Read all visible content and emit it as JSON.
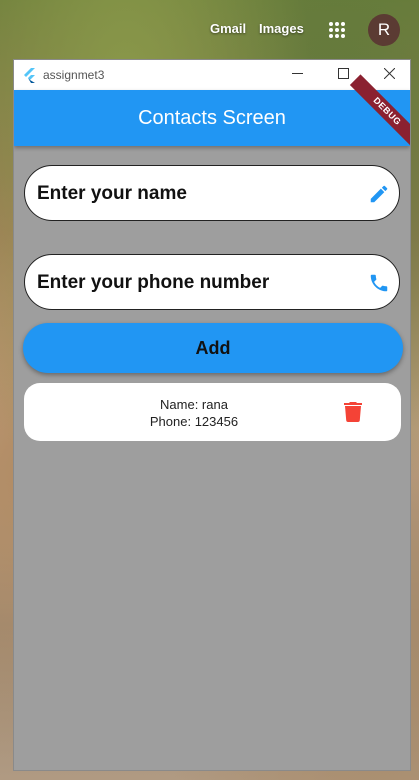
{
  "browser": {
    "links": [
      "Gmail",
      "Images"
    ],
    "avatar_letter": "R"
  },
  "window": {
    "title": "assignmet3",
    "controls": [
      "minimize-icon",
      "maximize-icon",
      "close-icon"
    ]
  },
  "appbar": {
    "title": "Contacts Screen",
    "debug_banner": "DEBUG",
    "color": "#2196f3"
  },
  "form": {
    "name_placeholder": "Enter your name",
    "name_icon": "pencil-icon",
    "phone_placeholder": "Enter your phone number",
    "phone_icon": "phone-icon",
    "add_label": "Add"
  },
  "contacts": [
    {
      "name": "Name: rana",
      "phone": "Phone: 123456",
      "action_icon": "trash-icon"
    }
  ],
  "colors": {
    "accent": "#2196f3",
    "background": "#9e9e9e",
    "delete": "#f44336"
  }
}
